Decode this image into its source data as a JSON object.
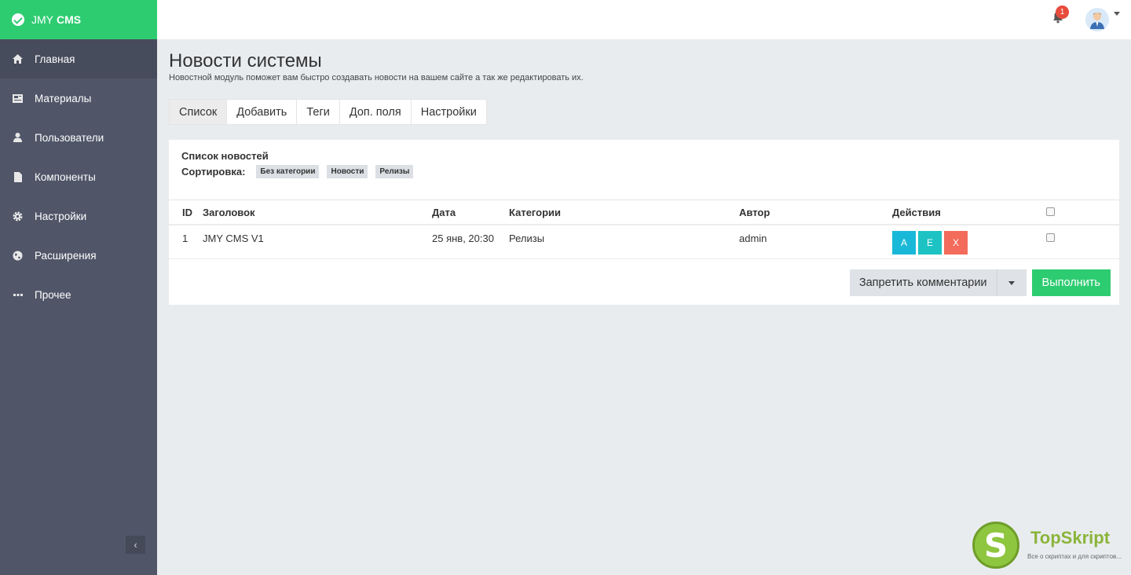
{
  "brand": {
    "name_light": "JMY",
    "name_bold": "CMS"
  },
  "sidebar": {
    "items": [
      {
        "label": "Главная",
        "icon": "home-icon"
      },
      {
        "label": "Материалы",
        "icon": "newspaper-icon"
      },
      {
        "label": "Пользователи",
        "icon": "user-icon"
      },
      {
        "label": "Компоненты",
        "icon": "file-icon"
      },
      {
        "label": "Настройки",
        "icon": "gear-icon"
      },
      {
        "label": "Расширения",
        "icon": "globe-icon"
      },
      {
        "label": "Прочее",
        "icon": "ellipsis-icon"
      }
    ],
    "collapse_glyph": "‹"
  },
  "topbar": {
    "notifications_count": "1"
  },
  "page": {
    "title": "Новости системы",
    "description": "Новостной модуль поможет вам быстро создавать новости на вашем сайте а так же редактировать их."
  },
  "tabs": [
    "Список",
    "Добавить",
    "Теги",
    "Доп. поля",
    "Настройки"
  ],
  "panel": {
    "title": "Список новостей",
    "sort_label": "Сортировка:",
    "sort_chips": [
      "Без категории",
      "Новости",
      "Релизы"
    ]
  },
  "table": {
    "headers": {
      "id": "ID",
      "title": "Заголовок",
      "date": "Дата",
      "category": "Категории",
      "author": "Автор",
      "actions": "Действия"
    },
    "rows": [
      {
        "id": "1",
        "title": "JMY CMS V1",
        "date": "25 янв, 20:30",
        "category": "Релизы",
        "author": "admin",
        "actions": [
          "A",
          "E",
          "X"
        ]
      }
    ]
  },
  "bulk": {
    "selected_action": "Запретить комментарии",
    "run_label": "Выполнить"
  },
  "watermark": {
    "logo_letter": "S",
    "name": "TopSkript",
    "tagline": "Все о скриптах и для скриптов..."
  },
  "colors": {
    "accent": "#2ecc71",
    "sidebar": "#505668",
    "danger": "#f36b5b",
    "info": "#1ab8d8"
  }
}
